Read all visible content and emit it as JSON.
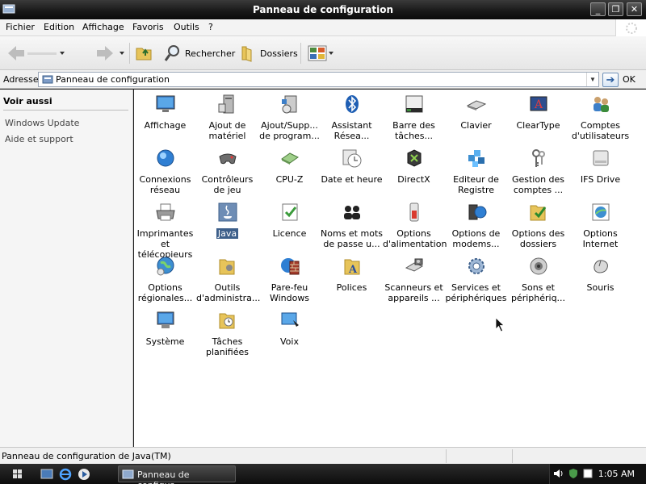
{
  "window": {
    "title": "Panneau de configuration",
    "minimize_label": "_",
    "maximize_label": "❐",
    "close_label": "✕"
  },
  "menu": [
    "Fichier",
    "Edition",
    "Affichage",
    "Favoris",
    "Outils",
    "?"
  ],
  "toolbar": {
    "search_label": "Rechercher",
    "folders_label": "Dossiers"
  },
  "address": {
    "label": "Adresse",
    "value": "Panneau de configuration",
    "go_label": "OK"
  },
  "left_pane": {
    "title": "Voir aussi",
    "links": [
      "Windows Update",
      "Aide et support"
    ]
  },
  "icons": [
    {
      "label": "Affichage",
      "icon": "display-icon"
    },
    {
      "label": "Ajout de matériel",
      "icon": "add-hardware-icon"
    },
    {
      "label": "Ajout/Supp... de program...",
      "icon": "add-remove-programs-icon"
    },
    {
      "label": "Assistant Résea...",
      "icon": "bluetooth-icon"
    },
    {
      "label": "Barre des tâches...",
      "icon": "taskbar-icon"
    },
    {
      "label": "Clavier",
      "icon": "keyboard-icon"
    },
    {
      "label": "ClearType",
      "icon": "cleartype-icon"
    },
    {
      "label": "Comptes d'utilisateurs",
      "icon": "user-accounts-icon"
    },
    {
      "label": "Connexions réseau",
      "icon": "network-icon"
    },
    {
      "label": "Contrôleurs de jeu",
      "icon": "gamepad-icon"
    },
    {
      "label": "CPU-Z",
      "icon": "cpu-icon"
    },
    {
      "label": "Date et heure",
      "icon": "clock-icon"
    },
    {
      "label": "DirectX",
      "icon": "directx-icon"
    },
    {
      "label": "Editeur de Registre",
      "icon": "registry-icon"
    },
    {
      "label": "Gestion des comptes ...",
      "icon": "keys-icon"
    },
    {
      "label": "IFS Drive",
      "icon": "drive-icon"
    },
    {
      "label": "Imprimantes et télécopieurs",
      "icon": "printer-icon"
    },
    {
      "label": "Java",
      "icon": "java-icon",
      "selected": true
    },
    {
      "label": "Licence",
      "icon": "license-icon"
    },
    {
      "label": "Noms et mots de passe u...",
      "icon": "users-icon"
    },
    {
      "label": "Options d'alimentation",
      "icon": "power-icon"
    },
    {
      "label": "Options de modems...",
      "icon": "modem-icon"
    },
    {
      "label": "Options des dossiers",
      "icon": "folder-options-icon"
    },
    {
      "label": "Options Internet",
      "icon": "internet-options-icon"
    },
    {
      "label": "Options régionales...",
      "icon": "globe-icon"
    },
    {
      "label": "Outils d'administra...",
      "icon": "admin-tools-icon"
    },
    {
      "label": "Pare-feu Windows",
      "icon": "firewall-icon"
    },
    {
      "label": "Polices",
      "icon": "fonts-icon"
    },
    {
      "label": "Scanneurs et appareils ...",
      "icon": "scanner-icon"
    },
    {
      "label": "Services et périphériques",
      "icon": "services-icon"
    },
    {
      "label": "Sons et périphériq...",
      "icon": "sounds-icon"
    },
    {
      "label": "Souris",
      "icon": "mouse-icon"
    },
    {
      "label": "Système",
      "icon": "system-icon"
    },
    {
      "label": "Tâches planifiées",
      "icon": "scheduled-tasks-icon"
    },
    {
      "label": "Voix",
      "icon": "speech-icon"
    }
  ],
  "status": {
    "text": "Panneau de configuration de Java(TM)"
  },
  "taskbar": {
    "task_label": "Panneau de configur...",
    "clock": "1:05 AM"
  },
  "colors": {
    "selection": "#3d5f8a",
    "taskbar": "#1a1a1a"
  }
}
